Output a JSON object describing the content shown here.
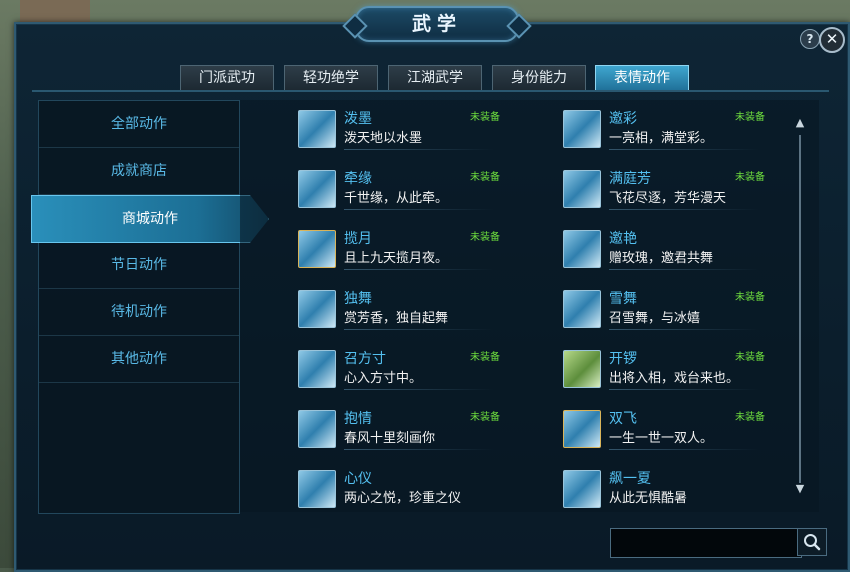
{
  "window": {
    "title": "武学"
  },
  "header_buttons": {
    "help": "?",
    "close": "✕"
  },
  "tabs": [
    {
      "label": "门派武功",
      "active": false
    },
    {
      "label": "轻功绝学",
      "active": false
    },
    {
      "label": "江湖武学",
      "active": false
    },
    {
      "label": "身份能力",
      "active": false
    },
    {
      "label": "表情动作",
      "active": true
    }
  ],
  "categories": [
    {
      "label": "全部动作",
      "active": false
    },
    {
      "label": "成就商店",
      "active": false
    },
    {
      "label": "商城动作",
      "active": true
    },
    {
      "label": "节日动作",
      "active": false
    },
    {
      "label": "待机动作",
      "active": false
    },
    {
      "label": "其他动作",
      "active": false
    }
  ],
  "actions": [
    {
      "name": "泼墨",
      "desc": "泼天地以水墨",
      "tag": "未装备",
      "icon": "ink-splash-icon"
    },
    {
      "name": "邀彩",
      "desc": "一亮相，满堂彩。",
      "tag": "未装备",
      "icon": "performer-icon"
    },
    {
      "name": "牵缘",
      "desc": "千世缘，从此牵。",
      "tag": "未装备",
      "icon": "dragon-icon"
    },
    {
      "name": "满庭芳",
      "desc": "飞花尽逐，芳华漫天",
      "tag": "未装备",
      "icon": "flower-dance-icon"
    },
    {
      "name": "揽月",
      "desc": "且上九天揽月夜。",
      "tag": "未装备",
      "icon": "moon-reach-icon"
    },
    {
      "name": "邀艳",
      "desc": "赠玫瑰，邀君共舞",
      "tag": "",
      "icon": "rose-dance-icon"
    },
    {
      "name": "独舞",
      "desc": "赏芳香，独自起舞",
      "tag": "",
      "icon": "solo-dance-icon"
    },
    {
      "name": "雪舞",
      "desc": "召雪舞，与冰嬉",
      "tag": "未装备",
      "icon": "snow-dance-icon"
    },
    {
      "name": "召方寸",
      "desc": "心入方寸中。",
      "tag": "未装备",
      "icon": "stage-icon"
    },
    {
      "name": "开锣",
      "desc": "出将入相，戏台来也。",
      "tag": "未装备",
      "icon": "opera-icon"
    },
    {
      "name": "抱情",
      "desc": "春风十里刻画你",
      "tag": "未装备",
      "icon": "embrace-icon"
    },
    {
      "name": "双飞",
      "desc": "一生一世一双人。",
      "tag": "未装备",
      "icon": "couple-fly-icon"
    },
    {
      "name": "心仪",
      "desc": "两心之悦，珍重之仪",
      "tag": "",
      "icon": "bow-couple-icon"
    },
    {
      "name": "飙一夏",
      "desc": "从此无惧酷暑",
      "tag": "",
      "icon": "summer-icon"
    }
  ],
  "search": {
    "placeholder": ""
  },
  "scroll": {
    "up": "▲",
    "down": "▼"
  }
}
